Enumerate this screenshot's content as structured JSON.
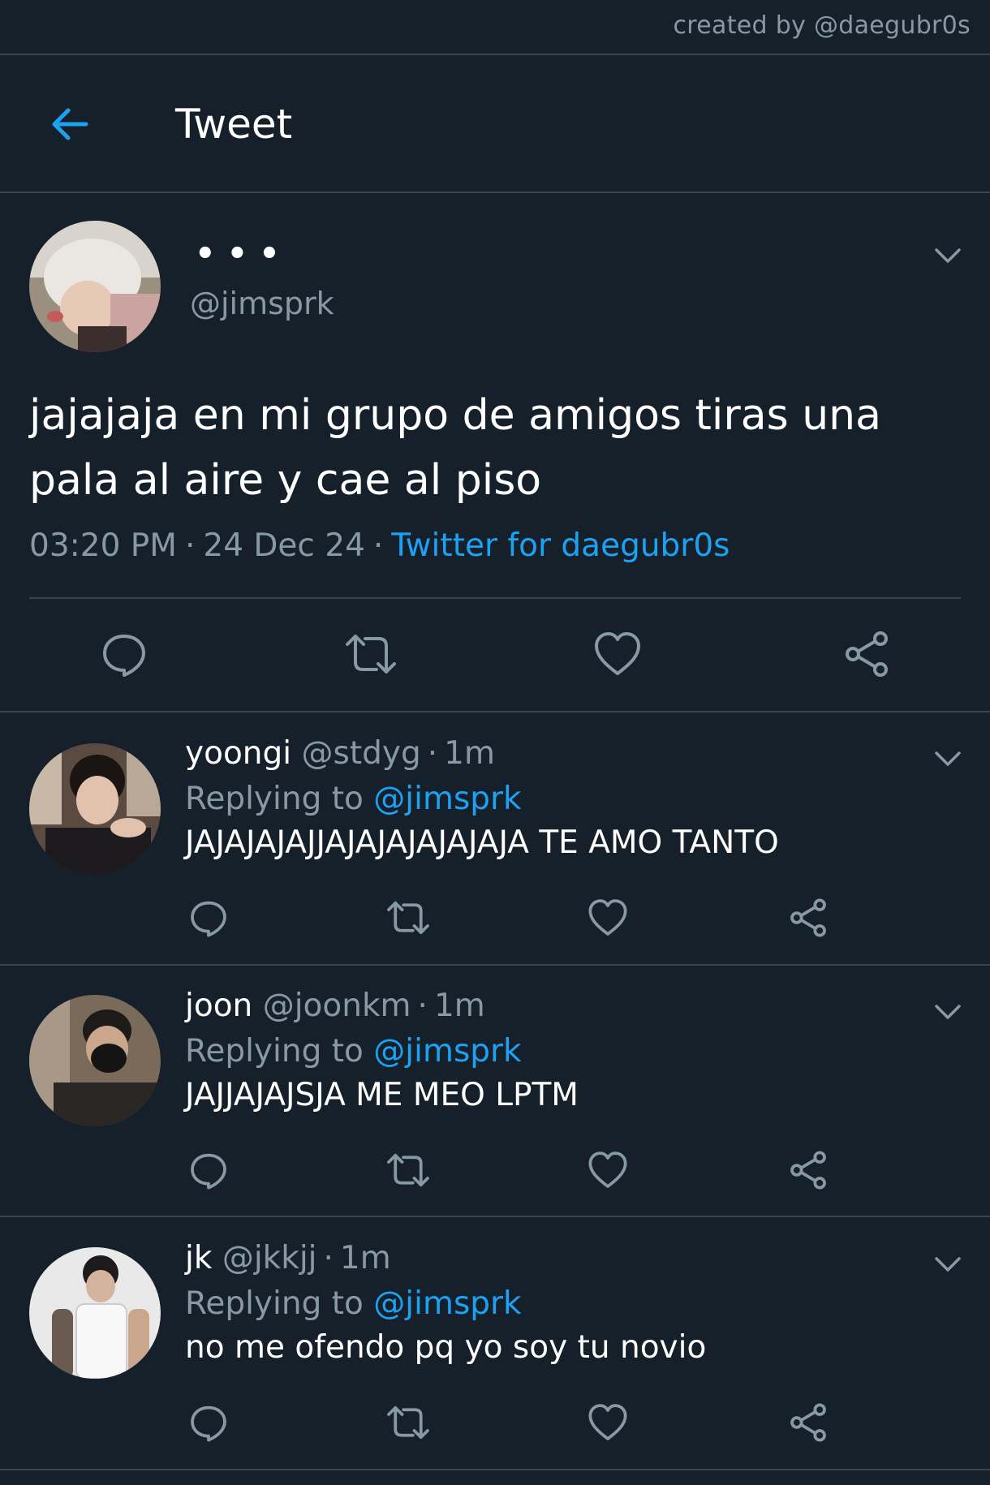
{
  "watermark": "created by @daegubr0s",
  "header": {
    "title": "Tweet",
    "back_icon": "arrow-left-icon"
  },
  "colors": {
    "background": "#15202b",
    "accent": "#1da1f2",
    "muted": "#8899a6",
    "divider": "#38444d"
  },
  "main_tweet": {
    "display_name": "•••",
    "handle": "@jimsprk",
    "text": "jajajaja en mi grupo de amigos tiras una pala al aire y cae al piso",
    "time": "03:20 PM",
    "date": "24 Dec 24",
    "source": "Twitter for daegubr0s",
    "separator": "·"
  },
  "replies": [
    {
      "name": "yoongi",
      "handle": "@stdyg",
      "time": "1m",
      "replying_prefix": "Replying to",
      "replying_to": "@jimsprk",
      "text": "JAJAJAJAJJAJAJAJAJAJAJA TE AMO TANTO"
    },
    {
      "name": "joon",
      "handle": "@joonkm",
      "time": "1m",
      "replying_prefix": "Replying to",
      "replying_to": "@jimsprk",
      "text": "JAJJAJAJSJA ME MEO LPTM"
    },
    {
      "name": "jk",
      "handle": "@jkkjj",
      "time": "1m",
      "replying_prefix": "Replying to",
      "replying_to": "@jimsprk",
      "text": "no me ofendo pq yo soy tu novio"
    }
  ],
  "action_icons": [
    "reply-icon",
    "retweet-icon",
    "like-icon",
    "share-icon"
  ]
}
